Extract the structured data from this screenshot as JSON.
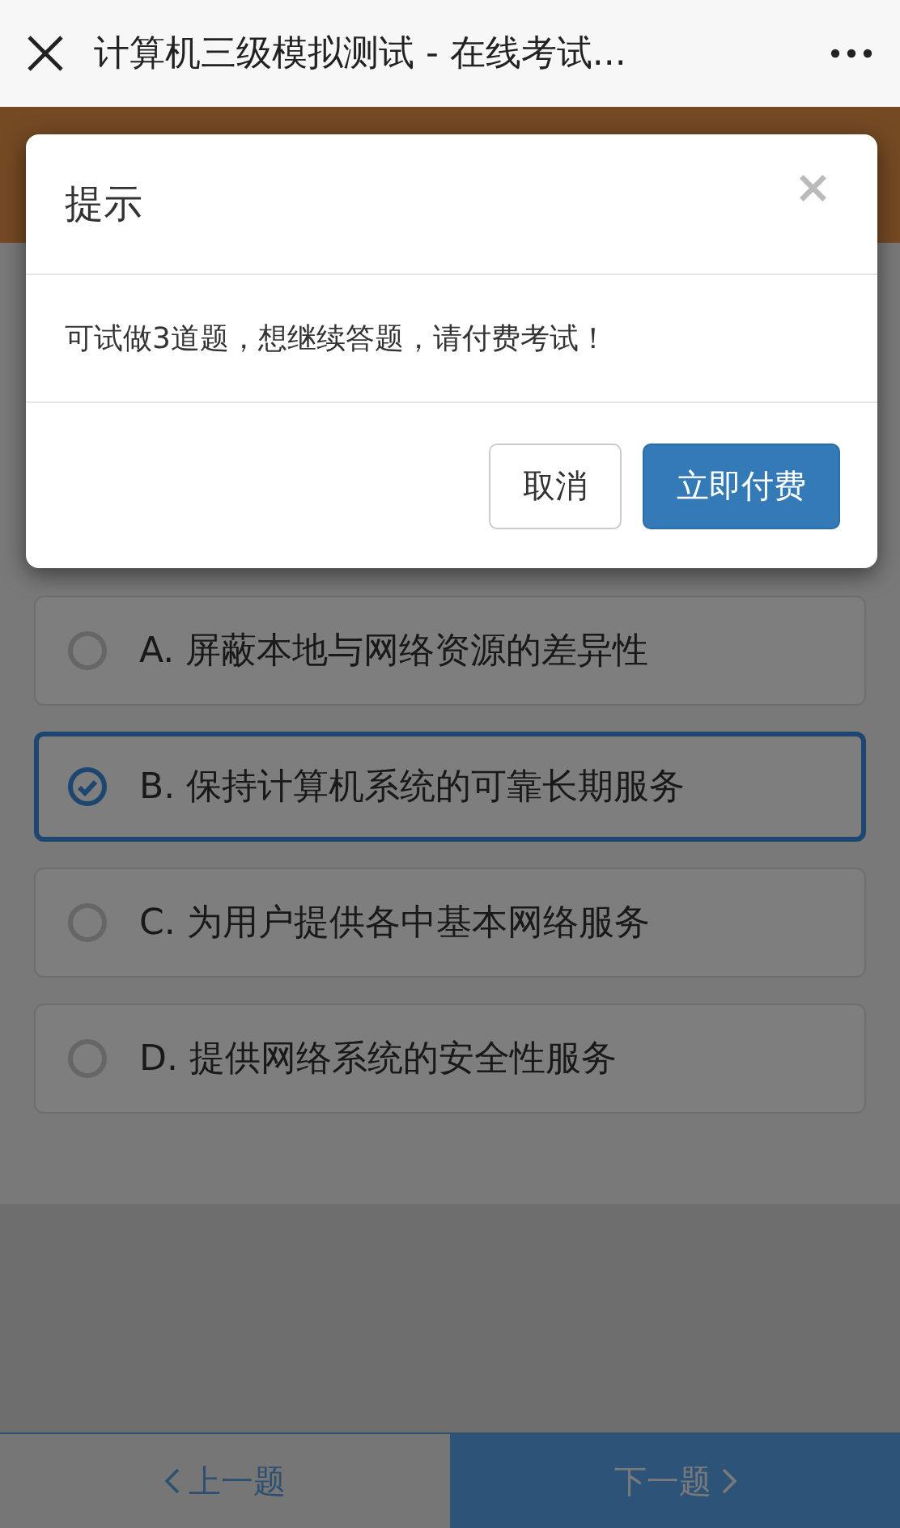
{
  "window": {
    "title": "计算机三级模拟测试 - 在线考试..."
  },
  "options": [
    {
      "label": "A. 屏蔽本地与网络资源的差异性",
      "selected": false
    },
    {
      "label": "B. 保持计算机系统的可靠长期服务",
      "selected": true
    },
    {
      "label": "C. 为用户提供各中基本网络服务",
      "selected": false
    },
    {
      "label": "D. 提供网络系统的安全性服务",
      "selected": false
    }
  ],
  "nav": [
    {
      "label": "上一题",
      "kind": "prev"
    },
    {
      "label": "下一题",
      "kind": "next"
    }
  ],
  "dialog": {
    "title": "提示",
    "close": "×",
    "message": "可试做3道题，想继续答题，请付费考试！",
    "buttons": [
      {
        "label": "取消",
        "kind": "default"
      },
      {
        "label": "立即付费",
        "kind": "primary"
      }
    ]
  }
}
